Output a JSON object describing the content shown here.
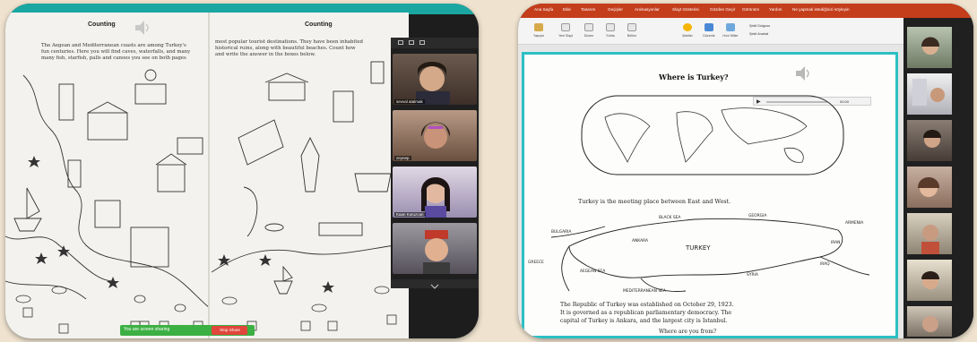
{
  "left_screen": {
    "book": {
      "left_page": {
        "heading": "Counting",
        "text_lines": [
          "The Aegean and Mediterranean coasts are among Turkey's",
          "fun centuries. Here you will find caves, waterfalls, and many",
          "many fish, starfish, palls and canoes you see on both pages"
        ]
      },
      "right_page": {
        "heading": "Counting",
        "text_lines": [
          "most popular tourist destinations. They have been inhabited",
          "historical ruins, along with beautiful beaches. Count how",
          "and write the answer in the boxes below."
        ]
      }
    },
    "participants": [
      {
        "name": "sevval atalmak"
      },
      {
        "name": "zeynep"
      },
      {
        "name": "Kaan Kutuzcan"
      },
      {
        "name": ""
      }
    ],
    "share_bar": {
      "status": "You are screen sharing",
      "stop_label": "Stop Share"
    }
  },
  "right_screen": {
    "ribbon_tabs": [
      "Ana Sayfa",
      "Ekle",
      "Tasarım",
      "Geçişler",
      "Animasyonlar",
      "Slayt Gösterisi",
      "Gözden Geçir",
      "Görünüm",
      "Yardım",
      "Ne yapmak istediğinizi söyleyin"
    ],
    "ribbon_buttons": [
      "Yapıştır",
      "Yeni Slayt",
      "Düzen",
      "Sıfırla",
      "Bölüm",
      "Şekiller",
      "Düzenle",
      "Hızlı Stiller"
    ],
    "ribbon_extra": [
      "Şekil Dolgusu",
      "Şekil Anahat"
    ],
    "slide": {
      "title": "Where is Turkey?",
      "media_time": "00:00",
      "subtitle": "Turkey is the meeting place between East and West.",
      "map_labels": [
        "BLACK SEA",
        "BULGARIA",
        "GREECE",
        "GEORGIA",
        "ARMENIA",
        "IRAN",
        "TURKEY",
        "ANKARA",
        "SYRIA",
        "IRAQ",
        "AEGEAN SEA",
        "MEDITERRANEAN SEA"
      ],
      "body_lines": [
        "The Republic of Turkey was established on October 29, 1923.",
        "It is governed as a republican parliamentary democracy. The",
        "capital of Turkey is Ankara, and the largest city is Istanbul."
      ],
      "footer": "Where are you from?"
    }
  },
  "colors": {
    "zoom_green": "#3cb043",
    "stop_red": "#e0463b",
    "ppt_orange": "#c43e1c",
    "slide_border": "#2bc0c4",
    "book_border": "#1aa7a1"
  }
}
